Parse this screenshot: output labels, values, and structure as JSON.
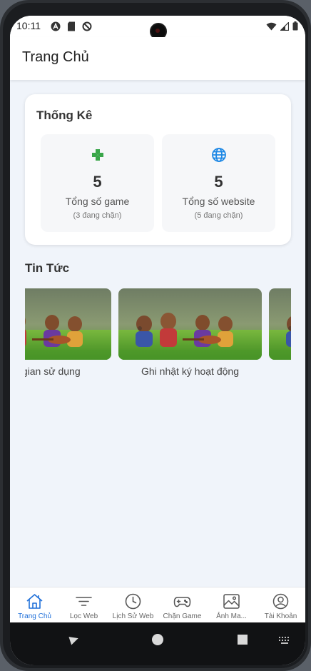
{
  "status_bar": {
    "time": "10:11",
    "left_icons": [
      "a-circle-icon",
      "sd-card-icon",
      "do-not-disturb-icon"
    ],
    "right_icons": [
      "wifi-icon",
      "cell-signal-icon",
      "battery-icon"
    ]
  },
  "app_bar": {
    "title": "Trang Chủ"
  },
  "stats": {
    "title": "Thống Kê",
    "tiles": [
      {
        "icon": "gamepad-icon",
        "icon_color": "#3aa64a",
        "value": "5",
        "label": "Tổng số game",
        "sub": "(3 đang chặn)"
      },
      {
        "icon": "globe-icon",
        "icon_color": "#1e88e5",
        "value": "5",
        "label": "Tổng số website",
        "sub": "(5 đang chặn)"
      }
    ]
  },
  "news": {
    "title": "Tin Tức",
    "items": [
      {
        "caption": "Thời gian sử dụng"
      },
      {
        "caption": "Ghi nhật ký hoạt động"
      },
      {
        "caption": ""
      }
    ]
  },
  "bottom_nav": {
    "active_color": "#1e6fd9",
    "items": [
      {
        "icon": "home-icon",
        "label": "Trang Chủ",
        "active": true
      },
      {
        "icon": "filter-icon",
        "label": "Lọc Web",
        "active": false
      },
      {
        "icon": "clock-icon",
        "label": "Lịch Sử Web",
        "active": false
      },
      {
        "icon": "gamepad-icon",
        "label": "Chặn Game",
        "active": false
      },
      {
        "icon": "image-icon",
        "label": "Ảnh Ma...",
        "active": false
      },
      {
        "icon": "account-icon",
        "label": "Tài Khoản",
        "active": false
      }
    ]
  },
  "system_nav": {
    "buttons": [
      "back-icon",
      "home-circle-icon",
      "recents-icon",
      "keyboard-icon"
    ]
  }
}
